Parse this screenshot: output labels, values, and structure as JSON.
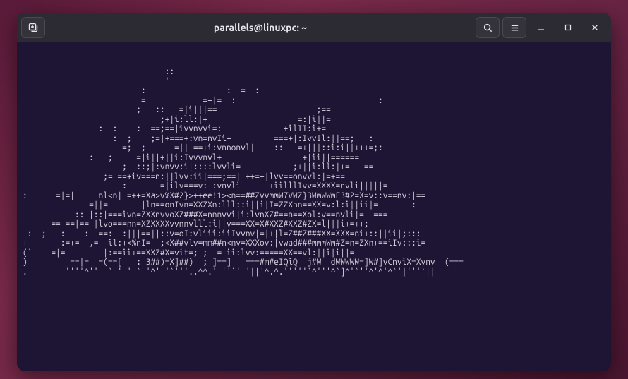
{
  "titlebar": {
    "title": "parallels@linuxpc: ~",
    "new_tab_icon": "new-tab-icon",
    "search_icon": "search-icon",
    "menu_icon": "hamburger-menu-icon",
    "minimize_icon": "minimize-icon",
    "maximize_icon": "maximize-icon",
    "close_icon": "close-icon"
  },
  "terminal": {
    "ascii": "\n\n                              ::\n                              '\n                         :                 :  =  :\n                         =            =+|=  :                              :\n                        ;   ::   =|i|||==                     ;==\n                             ;+|i:ll:|+                   =:|i||=\n                :  :    :  ==;==|ivvnvvi=:             +ilII:i+=\n                   :  ;    ;=|+===+:vn=nvIi+         ===+|:IvvIl:||==;   :\n                     =;  ;      =||+==+i:vnnonvl|    ::   =+|||::i:i||+++=;:\n              :   ;     =|i||+||i:Ivvvnvl+                 +|ii||======\n                     ;  ::;|:vnvv:i|::::lvvli=           ;+||i:ll:|+=   ==\n                 ;= ==+iv===n:||lvv:ii|===;==||++=+|lvv==onvvl:|=+==\n                     :       =|ilv===v:|:vnvli|     +iilllIvv=XXXX=nvli|||||=\n:      =|=|     nl<n| =++=Xa>v%X#2}>++ee!1><n==##ZvvmmW7VWZ}3WmWWmF3#2=X=v::v==nv:|==\n              =||=       |ln==onIvn=XXZXn:lll::i||i|I=ZZXnn==XX=v:l:i||ii|=       :\n           :: |::|===ivn=ZXXnvvoXZ###X=nnnvvi|i:lvnXZ#==n==Xol:v==nvli|=  ===\n      == ==|== |lvo===nn=XZXXXXvvnnvlll:i||v===XX=X#XXZ#XXZ#ZX=l|||i+=++;\n :  ;   :    :  ==:  :|||==||::v=oI:vliii:iiIvvnv|=|+|l=Z##Z###XX=XXX=ni+::||ii|;:::\n+       :=+=  ,=  il:+<%nI=  ;<X##vlv=mm##n<nv=XXXov:|vwad###mmmWm#Z=n=ZXn+==iIv:::i=\n(`    =|=        |:==ii+==XXZ#X=vit=; ;  =+ii:lvv:=====XX==vl:||i|i||=\n)         ==|=  =(==[   : 3##)=X]##)  ;|]==]   ===#m#eIQiQ  j#W  dWWWWW=]W#]vCnviX=Xvnv  (===\n.    -  -''''^''  ` ' ' ` '^' '`'''..^^.' ''`'''||'^.^.'''''`^'''^`]^'`''^'^'^`'|'''`||"
  }
}
